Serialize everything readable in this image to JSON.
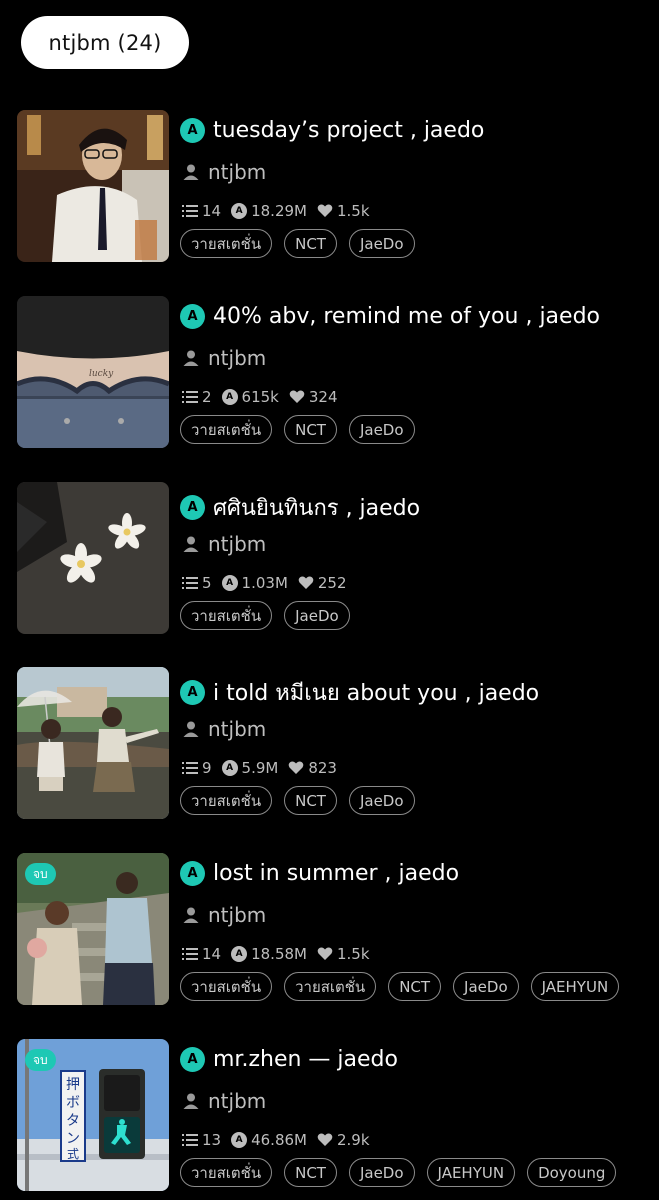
{
  "header": {
    "chip_label": "ntjbm (24)"
  },
  "colors": {
    "accent": "#1ec8b4",
    "background": "#000000",
    "muted_text": "#bdbdbd"
  },
  "icons": {
    "status": "a-circle-icon",
    "author": "person-icon",
    "parts": "list-icon",
    "reads": "a-circle-icon",
    "votes": "heart-icon"
  },
  "stories": [
    {
      "title": "tuesday’s project , jaedo",
      "author": "ntjbm",
      "parts": "14",
      "reads": "18.29M",
      "votes": "1.5k",
      "tags": [
        "วายสเตชั่น",
        "NCT",
        "JaeDo"
      ],
      "badge": ""
    },
    {
      "title": "40% abv, remind me of you , jaedo",
      "author": "ntjbm",
      "parts": "2",
      "reads": "615k",
      "votes": "324",
      "tags": [
        "วายสเตชั่น",
        "NCT",
        "JaeDo"
      ],
      "badge": ""
    },
    {
      "title": "ศศินยินทินกร , jaedo",
      "author": "ntjbm",
      "parts": "5",
      "reads": "1.03M",
      "votes": "252",
      "tags": [
        "วายสเตชั่น",
        "JaeDo"
      ],
      "badge": ""
    },
    {
      "title": "i told หมีเนย about you , jaedo",
      "author": "ntjbm",
      "parts": "9",
      "reads": "5.9M",
      "votes": "823",
      "tags": [
        "วายสเตชั่น",
        "NCT",
        "JaeDo"
      ],
      "badge": ""
    },
    {
      "title": "lost in summer , jaedo",
      "author": "ntjbm",
      "parts": "14",
      "reads": "18.58M",
      "votes": "1.5k",
      "tags": [
        "วายสเตชั่น",
        "วายสเตชั่น",
        "NCT",
        "JaeDo",
        "JAEHYUN"
      ],
      "badge": "จบ"
    },
    {
      "title": "mr.zhen — jaedo",
      "author": "ntjbm",
      "parts": "13",
      "reads": "46.86M",
      "votes": "2.9k",
      "tags": [
        "วายสเตชั่น",
        "NCT",
        "JaeDo",
        "JAEHYUN",
        "Doyoung"
      ],
      "badge": "จบ"
    }
  ]
}
